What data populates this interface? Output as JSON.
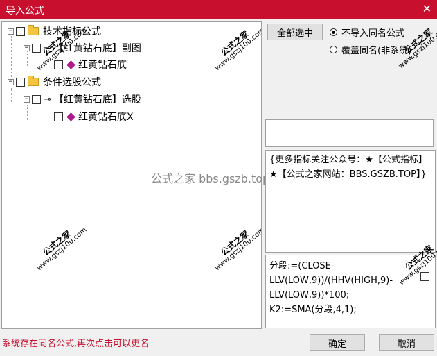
{
  "window": {
    "title": "导入公式",
    "close_glyph": "✕"
  },
  "tree": {
    "nodes": [
      {
        "label": "技术指标公式",
        "expander": "−"
      },
      {
        "label": "【红黄钻石底】副图",
        "expander": "−"
      },
      {
        "label": "红黄钻石底"
      },
      {
        "label": "条件选股公式",
        "expander": "−"
      },
      {
        "label": "【红黄钻石底】选股",
        "expander": "−"
      },
      {
        "label": "红黄钻石底X"
      }
    ]
  },
  "select_all_button": "全部选中",
  "options": {
    "no_import_same_name": "不导入同名公式",
    "overwrite_same_name": "覆盖同名(非系统)"
  },
  "info_text": "{更多指标关注公众号：★【公式指标】★【公式之家网站：BBS.GSZB.TOP】}",
  "formula_text": "分段:=(CLOSE-LLV(LOW,9))/(HHV(HIGH,9)-LLV(LOW,9))*100;\nK2:=SMA(分段,4,1);",
  "center_mark": "公式之家 bbs.gszb.top",
  "watermark": {
    "line1": "公式之家",
    "line2": "www.gszj100.com"
  },
  "status_text": "系统存在同名公式,再次点击可以更名",
  "ok_button": "确定",
  "cancel_button": "取消",
  "colors": {
    "titlebar": "#c8102e",
    "status": "#c8102e",
    "diamond": "#b0198c"
  }
}
